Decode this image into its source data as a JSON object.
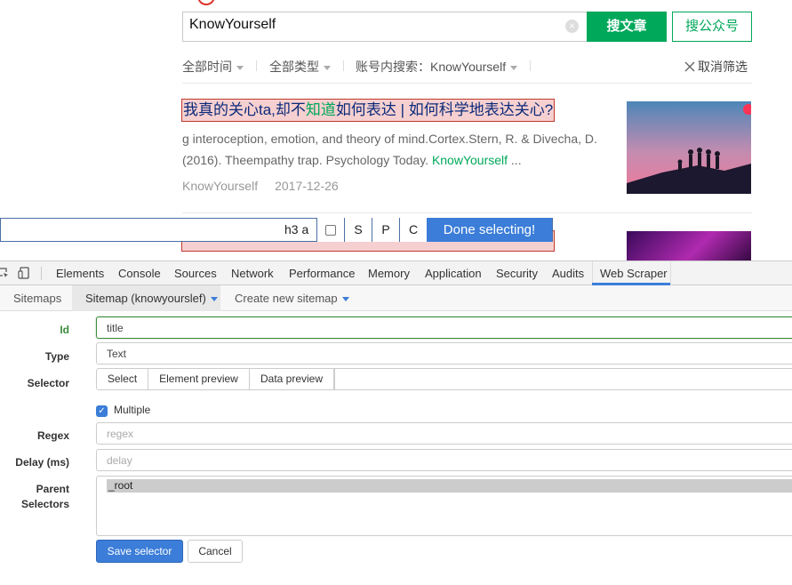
{
  "search": {
    "query": "KnowYourself",
    "clear_icon": "close-circle-icon",
    "search_articles_label": "搜文章",
    "search_accounts_label": "搜公众号"
  },
  "filters": {
    "time": "全部时间",
    "type": "全部类型",
    "account_search_label": "账号内搜索：",
    "account_search_value": "KnowYourself",
    "clear_label": "取消筛选"
  },
  "results": [
    {
      "title_before": "我真的关心ta,却不",
      "title_highlight": "知道",
      "title_after": "如何表达 | 如何科学地表达关心?",
      "snippet_line1": "g interoception, emotion, and theory of mind.Cortex.Stern, R. & Divecha, D.",
      "snippet_line2_before": "(2016). Theempathy trap. Psychology Today. ",
      "snippet_line2_highlight": "KnowYourself",
      "snippet_line2_after": " ...",
      "source": "KnowYourself",
      "date": "2017-12-26"
    }
  ],
  "selector_toolbar": {
    "selector_text": "h3 a",
    "option_s": "S",
    "option_p": "P",
    "option_c": "C",
    "done_label": "Done selecting!"
  },
  "devtools": {
    "tabs": [
      "Elements",
      "Console",
      "Sources",
      "Network",
      "Performance",
      "Memory",
      "Application",
      "Security",
      "Audits",
      "Web Scraper"
    ],
    "active_tab": "Web Scraper"
  },
  "webscraper": {
    "nav": {
      "sitemaps": "Sitemaps",
      "current_sitemap": "Sitemap (knowyourslef)",
      "create_new": "Create new sitemap"
    },
    "form": {
      "id_label": "Id",
      "id_value": "title",
      "type_label": "Type",
      "type_value": "Text",
      "selector_label": "Selector",
      "select_button": "Select",
      "element_preview_button": "Element preview",
      "data_preview_button": "Data preview",
      "selector_value": "",
      "multiple_label": "Multiple",
      "multiple_checked": true,
      "regex_label": "Regex",
      "regex_placeholder": "regex",
      "delay_label": "Delay (ms)",
      "delay_placeholder": "delay",
      "parent_label_line1": "Parent",
      "parent_label_line2": "Selectors",
      "parent_option": "_root",
      "save_button": "Save selector",
      "cancel_button": "Cancel"
    }
  },
  "colors": {
    "brand_green": "#00a85a",
    "accent_blue": "#3b7dd8",
    "selection_red": "#c0392b"
  }
}
